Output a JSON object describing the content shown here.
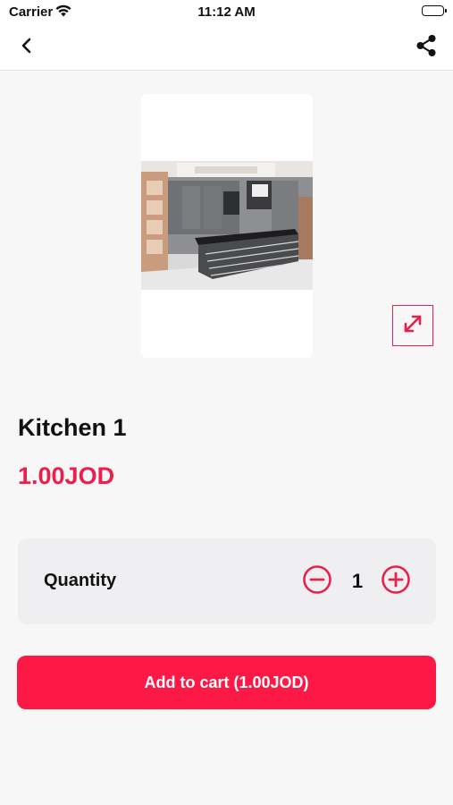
{
  "status_bar": {
    "carrier": "Carrier",
    "time": "11:12 AM"
  },
  "nav": {
    "back_icon": "chevron-left-icon",
    "share_icon": "share-icon"
  },
  "product": {
    "image_alt": "Kitchen 1 photo",
    "title": "Kitchen 1",
    "price": "1.00JOD"
  },
  "quantity": {
    "label": "Quantity",
    "value": "1",
    "minus_icon": "minus-circle-icon",
    "plus_icon": "plus-circle-icon"
  },
  "actions": {
    "add_to_cart_label": "Add to cart (1.00JOD)",
    "expand_icon": "expand-icon"
  },
  "colors": {
    "accent": "#e8204b",
    "button": "#fd1946",
    "background": "#f7f7f7",
    "panel": "#efeff2"
  }
}
